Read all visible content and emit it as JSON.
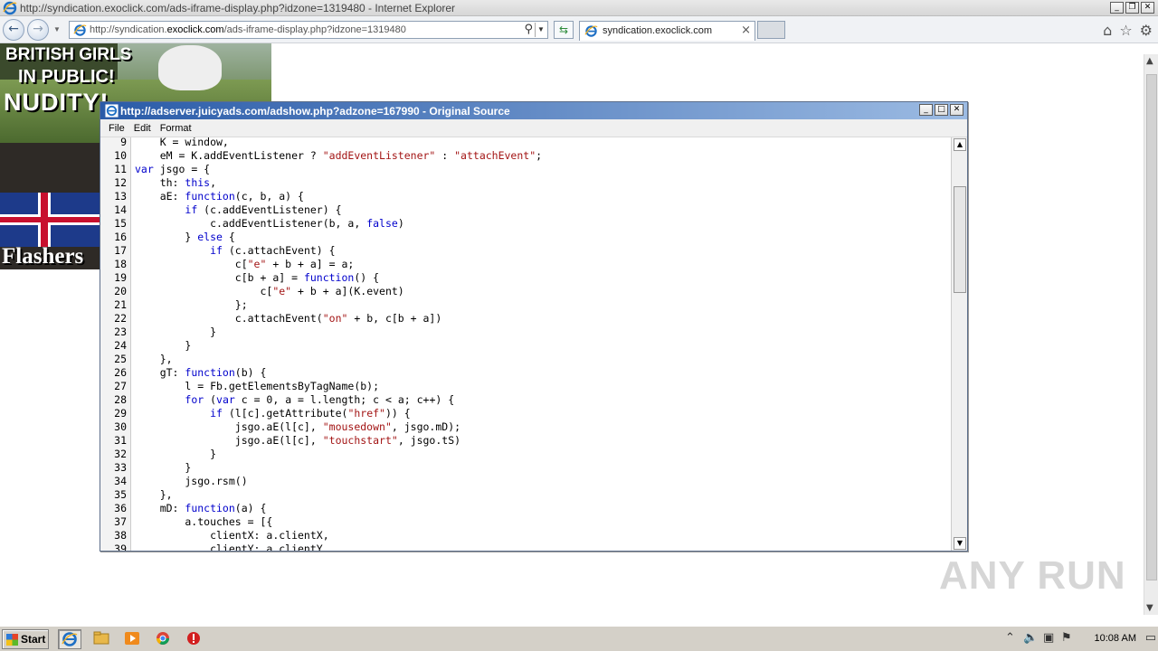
{
  "browser": {
    "window_title": "http://syndication.exoclick.com/ads-iframe-display.php?idzone=1319480 - Internet Explorer",
    "address_prefix": "http://syndication.",
    "address_domain": "exoclick.com",
    "address_suffix": "/ads-iframe-display.php?idzone=1319480",
    "tab_label": "syndication.exoclick.com"
  },
  "ad": {
    "line1": "BRITISH GIRLS",
    "line2": "IN PUBLIC!",
    "line3": "NUDITY!",
    "flag_text": "UK",
    "footer": "Flashers"
  },
  "source_window": {
    "title": "http://adserver.juicyads.com/adshow.php?adzone=167990 - Original Source",
    "menu": [
      "File",
      "Edit",
      "Format"
    ],
    "lines": [
      {
        "n": "9",
        "segs": [
          {
            "t": "    K = window,",
            "c": ""
          }
        ]
      },
      {
        "n": "10",
        "segs": [
          {
            "t": "    eM = K.addEventListener ? ",
            "c": ""
          },
          {
            "t": "\"addEventListener\"",
            "c": "str"
          },
          {
            "t": " : ",
            "c": ""
          },
          {
            "t": "\"attachEvent\"",
            "c": "str"
          },
          {
            "t": ";",
            "c": ""
          }
        ]
      },
      {
        "n": "11",
        "segs": [
          {
            "t": "var",
            "c": "kw"
          },
          {
            "t": " jsgo = {",
            "c": ""
          }
        ]
      },
      {
        "n": "12",
        "segs": [
          {
            "t": "    th: ",
            "c": ""
          },
          {
            "t": "this",
            "c": "kw"
          },
          {
            "t": ",",
            "c": ""
          }
        ]
      },
      {
        "n": "13",
        "segs": [
          {
            "t": "    aE: ",
            "c": ""
          },
          {
            "t": "function",
            "c": "kw"
          },
          {
            "t": "(c, b, a) {",
            "c": ""
          }
        ]
      },
      {
        "n": "14",
        "segs": [
          {
            "t": "        ",
            "c": ""
          },
          {
            "t": "if",
            "c": "kw"
          },
          {
            "t": " (c.addEventListener) {",
            "c": ""
          }
        ]
      },
      {
        "n": "15",
        "segs": [
          {
            "t": "            c.addEventListener(b, a, ",
            "c": ""
          },
          {
            "t": "false",
            "c": "kw"
          },
          {
            "t": ")",
            "c": ""
          }
        ]
      },
      {
        "n": "16",
        "segs": [
          {
            "t": "        } ",
            "c": ""
          },
          {
            "t": "else",
            "c": "kw"
          },
          {
            "t": " {",
            "c": ""
          }
        ]
      },
      {
        "n": "17",
        "segs": [
          {
            "t": "            ",
            "c": ""
          },
          {
            "t": "if",
            "c": "kw"
          },
          {
            "t": " (c.attachEvent) {",
            "c": ""
          }
        ]
      },
      {
        "n": "18",
        "segs": [
          {
            "t": "                c[",
            "c": ""
          },
          {
            "t": "\"e\"",
            "c": "str"
          },
          {
            "t": " + b + a] = a;",
            "c": ""
          }
        ]
      },
      {
        "n": "19",
        "segs": [
          {
            "t": "                c[b + a] = ",
            "c": ""
          },
          {
            "t": "function",
            "c": "kw"
          },
          {
            "t": "() {",
            "c": ""
          }
        ]
      },
      {
        "n": "20",
        "segs": [
          {
            "t": "                    c[",
            "c": ""
          },
          {
            "t": "\"e\"",
            "c": "str"
          },
          {
            "t": " + b + a](K.event)",
            "c": ""
          }
        ]
      },
      {
        "n": "21",
        "segs": [
          {
            "t": "                };",
            "c": ""
          }
        ]
      },
      {
        "n": "22",
        "segs": [
          {
            "t": "                c.attachEvent(",
            "c": ""
          },
          {
            "t": "\"on\"",
            "c": "str"
          },
          {
            "t": " + b, c[b + a])",
            "c": ""
          }
        ]
      },
      {
        "n": "23",
        "segs": [
          {
            "t": "            }",
            "c": ""
          }
        ]
      },
      {
        "n": "24",
        "segs": [
          {
            "t": "        }",
            "c": ""
          }
        ]
      },
      {
        "n": "25",
        "segs": [
          {
            "t": "    },",
            "c": ""
          }
        ]
      },
      {
        "n": "26",
        "segs": [
          {
            "t": "    gT: ",
            "c": ""
          },
          {
            "t": "function",
            "c": "kw"
          },
          {
            "t": "(b) {",
            "c": ""
          }
        ]
      },
      {
        "n": "27",
        "segs": [
          {
            "t": "        l = Fb.getElementsByTagName(b);",
            "c": ""
          }
        ]
      },
      {
        "n": "28",
        "segs": [
          {
            "t": "        ",
            "c": ""
          },
          {
            "t": "for",
            "c": "kw"
          },
          {
            "t": " (",
            "c": ""
          },
          {
            "t": "var",
            "c": "kw"
          },
          {
            "t": " c = 0, a = l.length; c < a; c++) {",
            "c": ""
          }
        ]
      },
      {
        "n": "29",
        "segs": [
          {
            "t": "            ",
            "c": ""
          },
          {
            "t": "if",
            "c": "kw"
          },
          {
            "t": " (l[c].getAttribute(",
            "c": ""
          },
          {
            "t": "\"href\"",
            "c": "str"
          },
          {
            "t": ")) {",
            "c": ""
          }
        ]
      },
      {
        "n": "30",
        "segs": [
          {
            "t": "                jsgo.aE(l[c], ",
            "c": ""
          },
          {
            "t": "\"mousedown\"",
            "c": "str"
          },
          {
            "t": ", jsgo.mD);",
            "c": ""
          }
        ]
      },
      {
        "n": "31",
        "segs": [
          {
            "t": "                jsgo.aE(l[c], ",
            "c": ""
          },
          {
            "t": "\"touchstart\"",
            "c": "str"
          },
          {
            "t": ", jsgo.tS)",
            "c": ""
          }
        ]
      },
      {
        "n": "32",
        "segs": [
          {
            "t": "            }",
            "c": ""
          }
        ]
      },
      {
        "n": "33",
        "segs": [
          {
            "t": "        }",
            "c": ""
          }
        ]
      },
      {
        "n": "34",
        "segs": [
          {
            "t": "        jsgo.rsm()",
            "c": ""
          }
        ]
      },
      {
        "n": "35",
        "segs": [
          {
            "t": "    },",
            "c": ""
          }
        ]
      },
      {
        "n": "36",
        "segs": [
          {
            "t": "    mD: ",
            "c": ""
          },
          {
            "t": "function",
            "c": "kw"
          },
          {
            "t": "(a) {",
            "c": ""
          }
        ]
      },
      {
        "n": "37",
        "segs": [
          {
            "t": "        a.touches = [{",
            "c": ""
          }
        ]
      },
      {
        "n": "38",
        "segs": [
          {
            "t": "            clientX: a.clientX,",
            "c": ""
          }
        ]
      },
      {
        "n": "39",
        "segs": [
          {
            "t": "            clientY: a.clientY,",
            "c": ""
          }
        ]
      }
    ]
  },
  "watermark": "ANY RUN",
  "taskbar": {
    "start_label": "Start",
    "clock": "10:08 AM"
  },
  "colors": {
    "keyword": "#0000cc",
    "string": "#a31515",
    "title_gradient_start": "#2a5ba8"
  }
}
